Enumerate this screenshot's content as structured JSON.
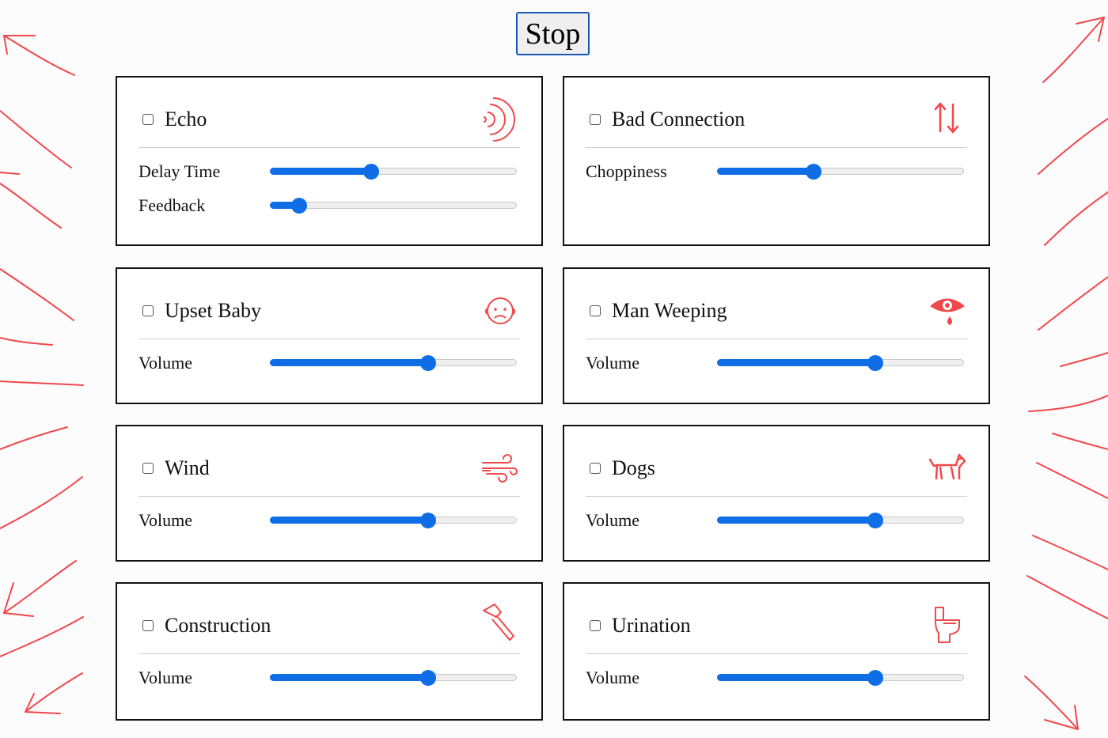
{
  "controls": {
    "stop_label": "Stop"
  },
  "accent_color": "#0f6ee6",
  "decoration_color": "#f0484b",
  "effects": [
    {
      "title": "Echo",
      "icon": "sound-waves-icon",
      "checked": false,
      "params": [
        {
          "label": "Delay Time",
          "value": 0.41
        },
        {
          "label": "Feedback",
          "value": 0.12
        }
      ]
    },
    {
      "title": "Bad Connection",
      "icon": "up-down-arrows-icon",
      "checked": false,
      "params": [
        {
          "label": "Choppiness",
          "value": 0.39
        }
      ]
    },
    {
      "title": "Upset Baby",
      "icon": "frowning-face-icon",
      "checked": false,
      "params": [
        {
          "label": "Volume",
          "value": 0.64
        }
      ]
    },
    {
      "title": "Man Weeping",
      "icon": "crying-eye-icon",
      "checked": false,
      "params": [
        {
          "label": "Volume",
          "value": 0.64
        }
      ]
    },
    {
      "title": "Wind",
      "icon": "wind-icon",
      "checked": false,
      "params": [
        {
          "label": "Volume",
          "value": 0.64
        }
      ]
    },
    {
      "title": "Dogs",
      "icon": "dog-icon",
      "checked": false,
      "params": [
        {
          "label": "Volume",
          "value": 0.64
        }
      ]
    },
    {
      "title": "Construction",
      "icon": "hammer-icon",
      "checked": false,
      "params": [
        {
          "label": "Volume",
          "value": 0.64
        }
      ]
    },
    {
      "title": "Urination",
      "icon": "toilet-icon",
      "checked": false,
      "params": [
        {
          "label": "Volume",
          "value": 0.64
        }
      ]
    }
  ]
}
